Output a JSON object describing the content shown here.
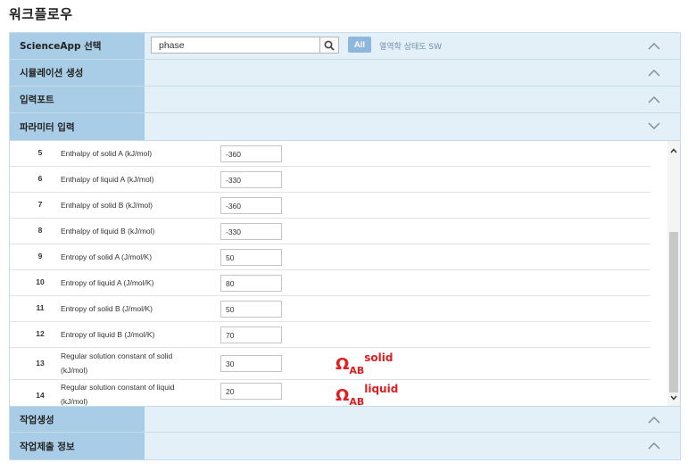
{
  "page_title": "워크플로우",
  "sections": {
    "science_app": {
      "label": "ScienceApp 선택",
      "search_value": "phase",
      "all_label": "All",
      "selected_app": "열역학 상태도 SW"
    },
    "simulation": {
      "label": "시뮬레이션 생성"
    },
    "input_port": {
      "label": "입력포트"
    },
    "parameter_input": {
      "label": "파라미터 입력"
    },
    "job_create": {
      "label": "작업생성"
    },
    "job_submit": {
      "label": "작업제출 정보"
    }
  },
  "parameters": [
    {
      "num": "5",
      "name": "Enthalpy of solid A (kJ/mol)",
      "value": "-360"
    },
    {
      "num": "6",
      "name": "Enthalpy of liquid A (kJ/mol)",
      "value": "-330"
    },
    {
      "num": "7",
      "name": "Enthalpy of solid B (kJ/mol)",
      "value": "-360"
    },
    {
      "num": "8",
      "name": "Enthalpy of liquid B (kJ/mol)",
      "value": "-330"
    },
    {
      "num": "9",
      "name": "Entropy of solid A (J/mol/K)",
      "value": "50"
    },
    {
      "num": "10",
      "name": "Entropy of liquid A (J/mol/K)",
      "value": "80"
    },
    {
      "num": "11",
      "name": "Entropy of solid B (J/mol/K)",
      "value": "50"
    },
    {
      "num": "12",
      "name": "Entropy of liquid B (J/mol/K)",
      "value": "70"
    },
    {
      "num": "13",
      "name_line1": "Regular solution constant of solid",
      "name_line2": "(kJ/mol)",
      "value": "30"
    },
    {
      "num": "14",
      "name_line1": "Regular solution constant of liquid",
      "name_line2": "(kJ/mol)",
      "value": "20"
    }
  ],
  "annotations": {
    "solid": {
      "symbol": "Ω",
      "sub": "AB",
      "sup": "solid"
    },
    "liquid": {
      "symbol": "Ω",
      "sub": "AB",
      "sup": "liquid"
    }
  },
  "colors": {
    "header_label_bg": "#a9cde6",
    "header_body_bg": "#e4f0f8",
    "annotation": "#e02020",
    "all_button": "#8fb6dc"
  },
  "icons": {
    "search": "search-icon",
    "expand": "chevron-up-icon",
    "collapse": "chevron-down-icon"
  }
}
